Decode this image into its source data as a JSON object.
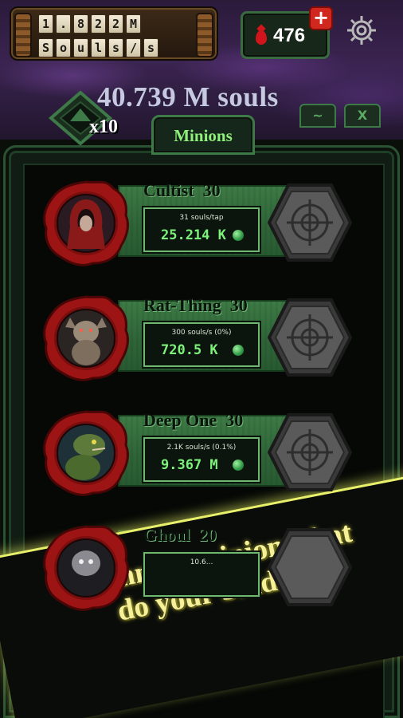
{
  "header": {
    "souls_per_sec_digits": [
      "1",
      ".",
      "8",
      "2",
      "2",
      "M"
    ],
    "souls_per_sec_unit": [
      "S",
      "o",
      "u",
      "l",
      "s",
      "/",
      "s"
    ],
    "blood_count": "476",
    "plus_label": "+",
    "total_souls": "40.739 M souls"
  },
  "tabs": {
    "multiplier": "x10",
    "active": "Minions",
    "mini_tab_1": "~",
    "mini_tab_2": "X"
  },
  "minions": [
    {
      "name": "Cultist",
      "level": "30",
      "rate": "31 souls/tap",
      "cost": "25.214 K"
    },
    {
      "name": "Rat-Thing",
      "level": "30",
      "rate": "300 souls/s (0%)",
      "cost": "720.5 K"
    },
    {
      "name": "Deep One",
      "level": "30",
      "rate": "2.1K souls/s (0.1%)",
      "cost": "9.367 M"
    },
    {
      "name": "Ghoul",
      "level": "20",
      "rate": "10.6...",
      "cost": ""
    }
  ],
  "promo": {
    "line1": "Summon minions that",
    "line2": "do your bidding!"
  },
  "colors": {
    "accent_green": "#7cf27a",
    "banner_green": "#3d7a45",
    "blood_red": "#d2151c",
    "promo_yellow": "#f6f09a"
  }
}
